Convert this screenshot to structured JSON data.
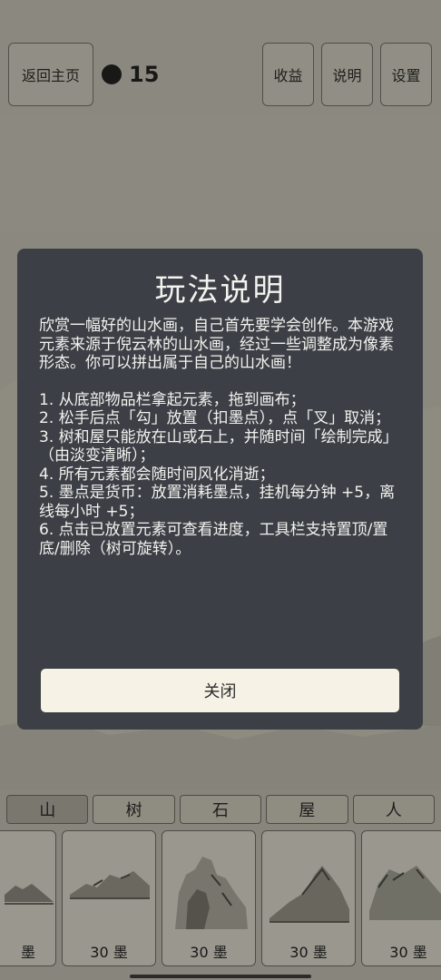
{
  "header": {
    "back_label": "返回主页",
    "ink_count": "15",
    "earnings_label": "收益",
    "help_label": "说明",
    "settings_label": "设置"
  },
  "modal": {
    "title": "玩法说明",
    "intro": "欣赏一幅好的山水画，自己首先要学会创作。本游戏元素来源于倪云林的山水画，经过一些调整成为像素形态。你可以拼出属于自己的山水画！",
    "rules": [
      "1. 从底部物品栏拿起元素，拖到画布；",
      "2. 松手后点「勾」放置（扣墨点），点「叉」取消；",
      "3. 树和屋只能放在山或石上，并随时间「绘制完成」（由淡变清晰）；",
      "4. 所有元素都会随时间风化消逝；",
      "5. 墨点是货币：放置消耗墨点，挂机每分钟 +5，离线每小时 +5；",
      "6. 点击已放置元素可查看进度，工具栏支持置顶/置底/删除（树可旋转）。"
    ],
    "close_label": "关闭"
  },
  "tabs": [
    {
      "label": "山",
      "active": true
    },
    {
      "label": "树",
      "active": false
    },
    {
      "label": "石",
      "active": false
    },
    {
      "label": "屋",
      "active": false
    },
    {
      "label": "人",
      "active": false
    }
  ],
  "items": [
    {
      "label": "墨",
      "icon": "mountain-icon"
    },
    {
      "label": "30 墨",
      "icon": "mountain-icon"
    },
    {
      "label": "30 墨",
      "icon": "rock-icon"
    },
    {
      "label": "30 墨",
      "icon": "mountain-icon"
    },
    {
      "label": "30 墨",
      "icon": "mountain-icon"
    }
  ],
  "colors": {
    "modal_bg": "#3c4046",
    "close_button_bg": "#f6f2e6",
    "page_bg": "#a29f94"
  }
}
